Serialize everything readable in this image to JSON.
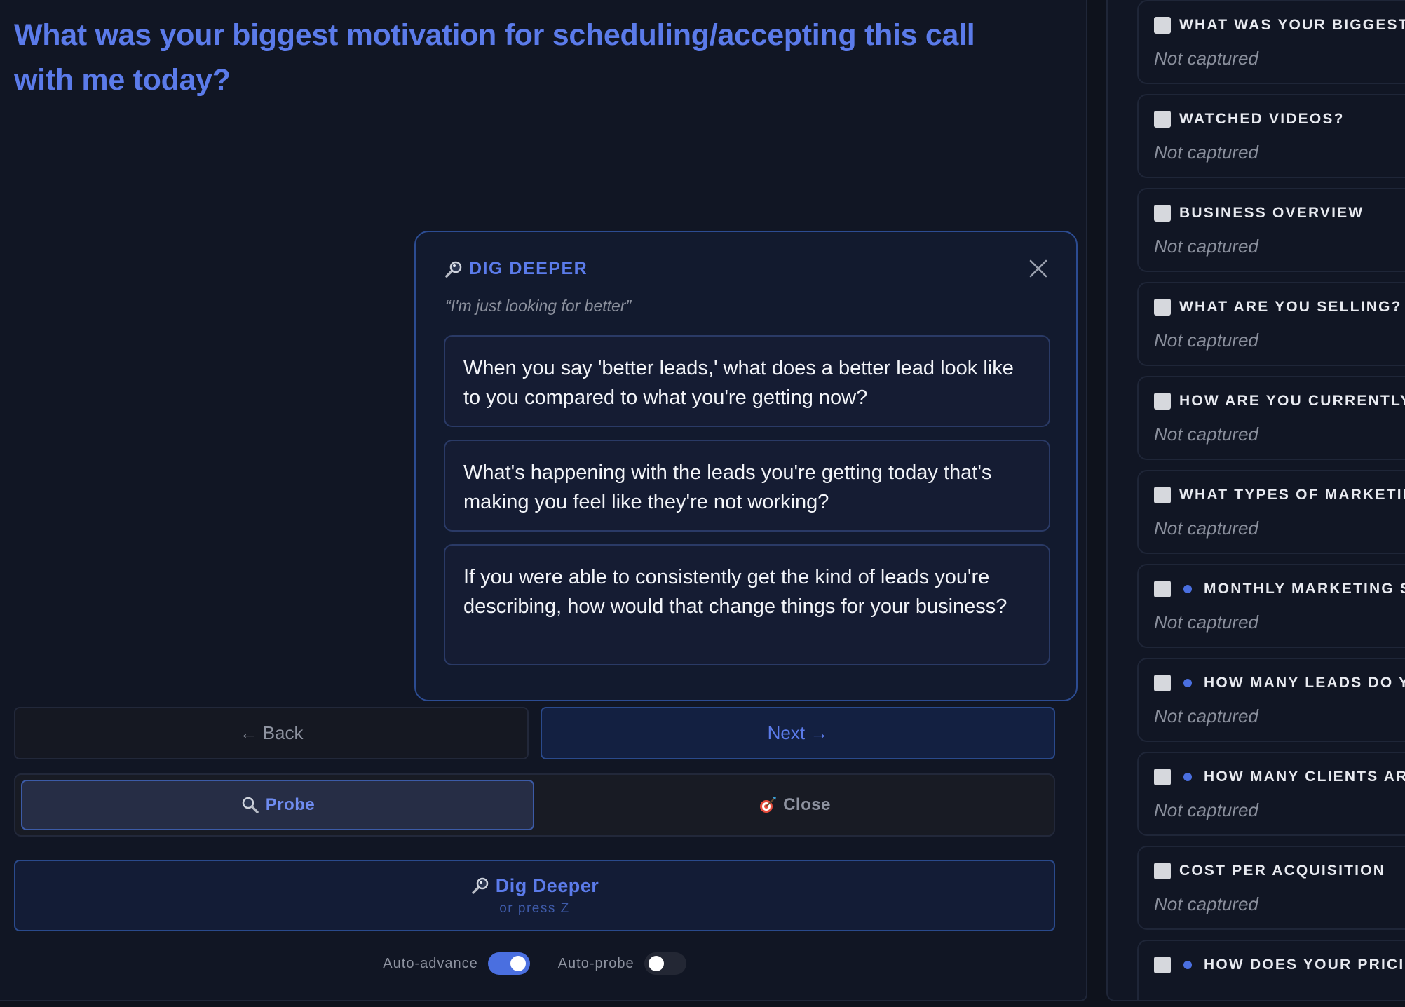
{
  "question": {
    "title": "What was your biggest motivation for scheduling/accepting this call with me today?"
  },
  "dig_deeper_popup": {
    "title": "DIG DEEPER",
    "quote": "“I'm just looking for better”",
    "suggestions": [
      "When you say 'better leads,' what does a better lead look like to you compared to what you're getting now?",
      "What's happening with the leads you're getting today that's making you feel like they're not working?",
      "If you were able to consistently get the kind of leads you're describing, how would that change things for your business?"
    ]
  },
  "navigation": {
    "back_label": "← Back",
    "next_label": "Next →"
  },
  "modes": {
    "probe_label": "Probe",
    "close_label": "Close",
    "active": "probe"
  },
  "dig_button": {
    "label": "Dig Deeper",
    "hint": "or press Z"
  },
  "toggles": {
    "auto_advance_label": "Auto-advance",
    "auto_advance_on": true,
    "auto_probe_label": "Auto-probe",
    "auto_probe_on": false
  },
  "sidebar": {
    "fields": [
      {
        "label": "WHAT WAS YOUR BIGGEST",
        "value": "Not captured",
        "dot": false
      },
      {
        "label": "WATCHED VIDEOS?",
        "value": "Not captured",
        "dot": false
      },
      {
        "label": "BUSINESS OVERVIEW",
        "value": "Not captured",
        "dot": false
      },
      {
        "label": "WHAT ARE YOU SELLING?",
        "value": "Not captured",
        "dot": false
      },
      {
        "label": "HOW ARE YOU CURRENTLY",
        "value": "Not captured",
        "dot": false
      },
      {
        "label": "WHAT TYPES OF MARKETIN",
        "value": "Not captured",
        "dot": false
      },
      {
        "label": "MONTHLY MARKETING S",
        "value": "Not captured",
        "dot": true
      },
      {
        "label": "HOW MANY LEADS DO YO",
        "value": "Not captured",
        "dot": true
      },
      {
        "label": "HOW MANY CLIENTS ARE",
        "value": "Not captured",
        "dot": true
      },
      {
        "label": "COST PER ACQUISITION",
        "value": "Not captured",
        "dot": false
      },
      {
        "label": "HOW DOES YOUR PRICIN",
        "value": "",
        "dot": true
      }
    ]
  },
  "colors": {
    "accent": "#5b7bea",
    "background": "#111624",
    "toggle_on": "#4a6fe0"
  }
}
